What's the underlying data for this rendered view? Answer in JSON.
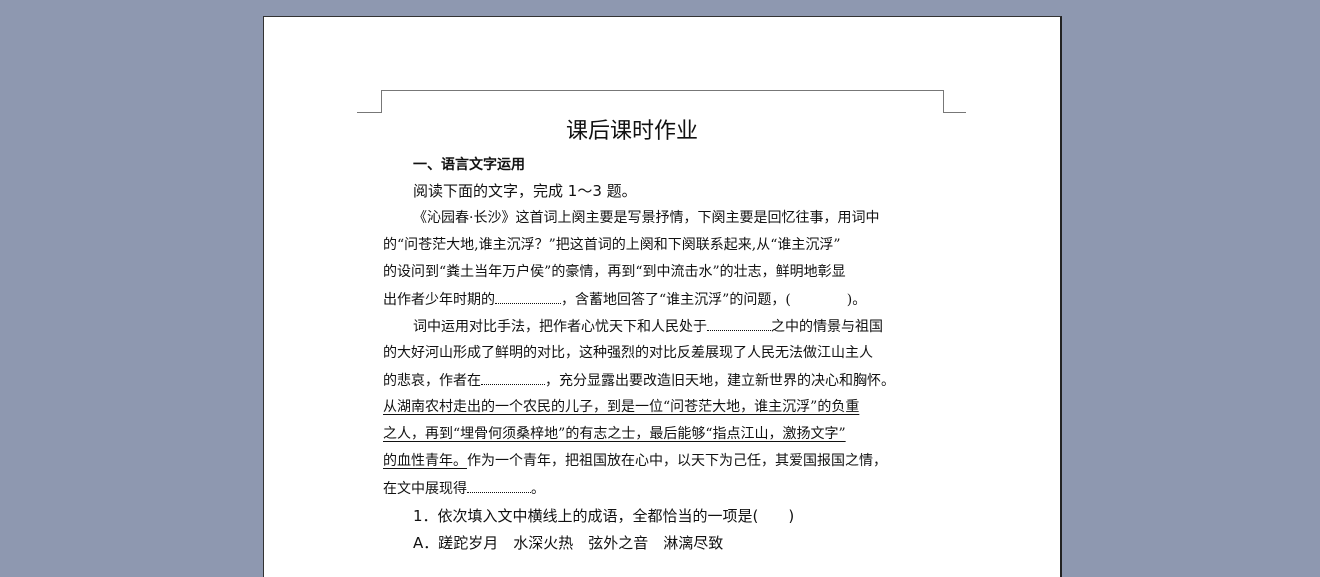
{
  "document": {
    "title": "课后课时作业",
    "section_heading": "一、语言文字运用",
    "instruction": "阅读下面的文字，完成 1～3 题。",
    "paragraph1": {
      "l1": "《沁园春·长沙》这首词上阕主要是写景抒情，下阕主要是回忆往事，用词中",
      "l2": "的“问苍茫大地,谁主沉浮？”把这首词的上阕和下阕联系起来,从“谁主沉浮”",
      "l3": "的设问到“粪土当年万户侯”的豪情，再到“到中流击水”的壮志，鲜明地彰显",
      "l4a": "出作者少年时期的",
      "l4b": "，含蓄地回答了“谁主沉浮”的问题，(　　　　)。"
    },
    "paragraph2": {
      "l1a": "词中运用对比手法，把作者心忧天下和人民处于",
      "l1b": "之中的情景与祖国",
      "l2": "的大好河山形成了鲜明的对比，这种强烈的对比反差展现了人民无法做江山主人",
      "l3a": "的悲哀，作者在",
      "l3b": "，充分显露出要改造旧天地，建立新世界的决心和胸怀。",
      "l4": "从湖南农村走出的一个农民的儿子，到是一位“问苍茫大地，谁主沉浮”的负重",
      "l5": "之人，再到“埋骨何须桑梓地”的有志之士，最后能够“指点江山，激扬文字”",
      "l6a": "的血性青年。",
      "l6b": "作为一个青年，把祖国放在心中，以天下为己任，其爱国报国之情，",
      "l7a": "在文中展现得",
      "l7b": "。"
    },
    "question1": "1．依次填入文中横线上的成语，全都恰当的一项是(　　)",
    "option_a": "A．蹉跎岁月　水深火热　弦外之音　淋漓尽致"
  }
}
